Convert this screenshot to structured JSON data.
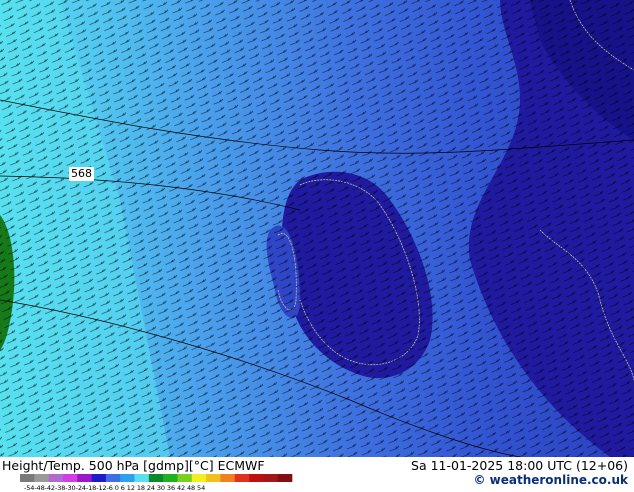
{
  "map": {
    "contour_label": "568",
    "colors": {
      "cyan": "#58e0f0",
      "light_blue": "#4aa8ee",
      "blue": "#3f6fe0",
      "medium_blue": "#2f46c8",
      "dark_blue": "#1f1aa0",
      "navy": "#16128a",
      "green": "#167a1a",
      "coastline": "#c8c8a0"
    }
  },
  "footer": {
    "title": "Height/Temp. 500 hPa [gdmp][°C] ECMWF",
    "datetime": "Sa 11-01-2025 18:00 UTC (12+06)",
    "copyright": "© weatheronline.co.uk",
    "legend_ticks": "-54-48-42-38-30-24-18-12-6  0  6  12  18  24  30  36  42  48  54",
    "legend_colors": [
      "#7a7a7a",
      "#9a9a9a",
      "#b06ad0",
      "#d040e0",
      "#9a18c8",
      "#1c1cc8",
      "#3f6fe0",
      "#2ea0f0",
      "#58e0f0",
      "#0a8a2a",
      "#20b020",
      "#7ad020",
      "#f0f020",
      "#f0c020",
      "#f08020",
      "#e03020",
      "#c01010",
      "#a01818",
      "#801010"
    ]
  }
}
